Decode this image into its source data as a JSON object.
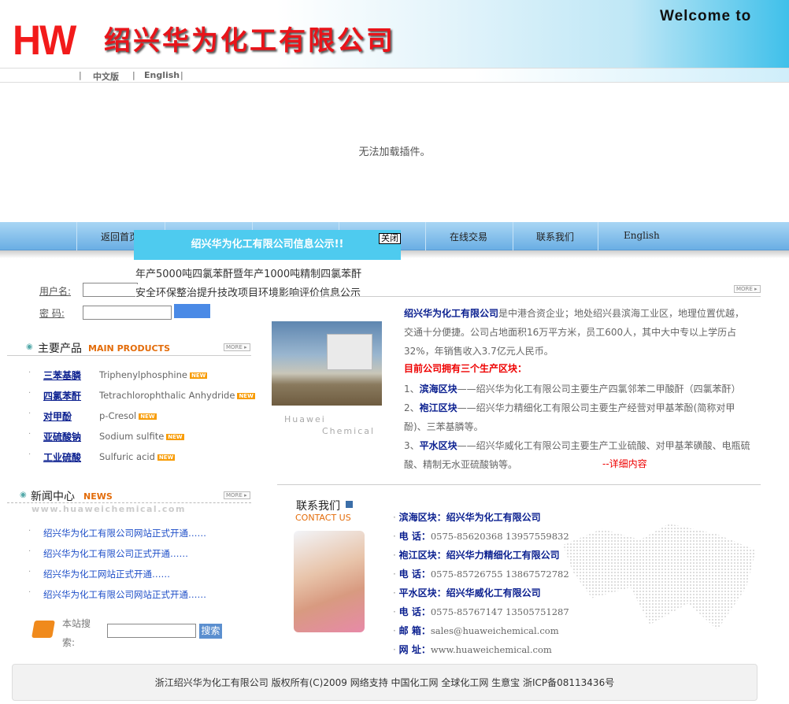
{
  "header": {
    "logo_mark": "HW",
    "company_name": "绍兴华为化工有限公司",
    "welcome": "Welcome to"
  },
  "lang": {
    "chinese": "中文版",
    "english": "English"
  },
  "plugin_message": "无法加载插件。",
  "nav": {
    "items": [
      {
        "label": "返回首页"
      },
      {
        "label": "在线交易"
      },
      {
        "label": "联系我们"
      },
      {
        "label": "English"
      }
    ]
  },
  "popup": {
    "title": "绍兴华为化工有限公司信息公示!!",
    "close": "关闭",
    "lines": [
      "年产5000吨四氯苯酐暨年产1000吨精制四氯苯酐",
      "安全环保整治提升技改项目环境影响评价信息公示"
    ]
  },
  "login": {
    "username_label": "用户名:",
    "password_label": "密 码:"
  },
  "products": {
    "title": "主要产品",
    "title_en": "MAIN PRODUCTS",
    "more": "MORE",
    "new_badge": "NEW",
    "items": [
      {
        "cn": "三苯基膦",
        "en": "Triphenylphosphine"
      },
      {
        "cn": "四氯苯酐",
        "en": "Tetrachlorophthalic Anhydride"
      },
      {
        "cn": "对甲酚",
        "en": "p-Cresol"
      },
      {
        "cn": "亚硫酸钠",
        "en": "Sodium sulfite"
      },
      {
        "cn": "工业硫酸",
        "en": "Sulfuric acid"
      }
    ]
  },
  "news": {
    "title": "新闻中心",
    "title_en": "NEWS",
    "more": "MORE",
    "watermark": "www.huaweichemical.com",
    "items": [
      "绍兴华为化工有限公司网站正式开通……",
      "绍兴华为化工有限公司正式开通……",
      "绍兴华为化工网站正式开通……",
      "绍兴华为化工有限公司网站正式开通……"
    ]
  },
  "search": {
    "label": "本站搜索:",
    "button": "搜索"
  },
  "about": {
    "more": "MORE",
    "image_caption_1": "Huawei",
    "image_caption_2": "Chemical",
    "company": "绍兴华为化工有限公司",
    "intro": "是中港合资企业；地处绍兴县滨海工业区，地理位置优越，交通十分便捷。公司占地面积16万平方米，员工600人，其中大中专以上学历占32%，年销售收入3.7亿元人民币。",
    "blocks_title": "目前公司拥有三个生产区块：",
    "blocks": [
      {
        "num": "1、",
        "name": "滨海区块",
        "desc": "——绍兴华为化工有限公司主要生产四氯邻苯二甲酸酐（四氯苯酐）"
      },
      {
        "num": "2、",
        "name": "袍江区块",
        "desc": "——绍兴华力精细化工有限公司主要生产经营对甲基苯酚(简称对甲酚)、三苯基膦等。"
      },
      {
        "num": "3、",
        "name": "平水区块",
        "desc": "——绍兴华威化工有限公司主要生产工业硫酸、对甲基苯磺酸、电瓶硫酸、精制无水亚硫酸钠等。"
      }
    ],
    "detail_link": "--详细内容"
  },
  "contact": {
    "title": "联系我们",
    "title_en": "CONTACT US",
    "rows": [
      {
        "label": "滨海区块：",
        "value": "绍兴华为化工有限公司",
        "bold": true
      },
      {
        "label": "电  话：",
        "value": "0575-85620368  13957559832"
      },
      {
        "label": "袍江区块：",
        "value": "绍兴华力精细化工有限公司",
        "bold": true
      },
      {
        "label": "电  话：",
        "value": "0575-85726755   13867572782"
      },
      {
        "label": "平水区块：",
        "value": "绍兴华威化工有限公司",
        "bold": true
      },
      {
        "label": "电  话：",
        "value": "0575-85767147   13505751287"
      },
      {
        "label": "邮  箱：",
        "value": "sales@huaweichemical.com"
      },
      {
        "label": "网  址：",
        "value": "www.huaweichemical.com"
      }
    ]
  },
  "footer": "浙江绍兴华为化工有限公司 版权所有(C)2009 网络支持 中国化工网 全球化工网 生意宝 浙ICP备08113436号",
  "colors": {
    "accent": "#4ecbef",
    "brand_red": "#e8141a",
    "link_blue": "#0a1f8f",
    "orange": "#e36c0a"
  }
}
